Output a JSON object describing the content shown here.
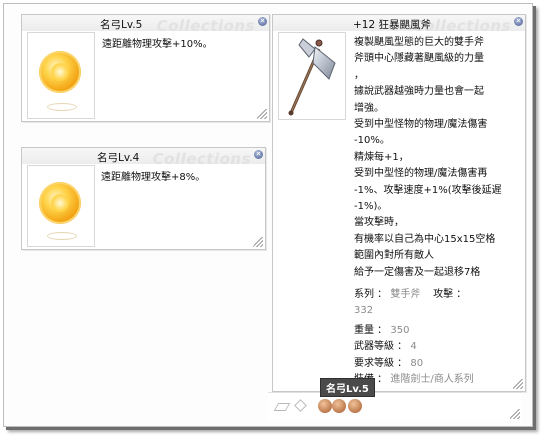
{
  "watermark": "Collections",
  "windows": [
    {
      "title": "名弓Lv.5",
      "desc": "遠距離物理攻擊+10%。"
    },
    {
      "title": "名弓Lv.4",
      "desc": "遠距離物理攻擊+8%。"
    }
  ],
  "item": {
    "title": "+12 狂暴颶風斧",
    "description_lines": [
      "複製颶風型態的巨大的雙手斧",
      "斧頭中心隱藏著颶風級的力量",
      "，",
      "據說武器越強時力量也會一起",
      "增強。",
      "受到中型怪物的物理/魔法傷害",
      "-10%。",
      "精煉每+1，",
      "受到中型怪的物理/魔法傷害再",
      "-1%、攻擊速度+1%(攻擊後延遲",
      "-1%)。",
      "當攻擊時，",
      "有機率以自己為中心15x15空格",
      "範圍內對所有敵人",
      "給予一定傷害及一起退移7格"
    ],
    "stats": {
      "series_label": "系列 ：",
      "series_value": "雙手斧",
      "attack_label": "攻擊 ：",
      "attack_value": "332",
      "weight_label": "重量 ：",
      "weight_value": "350",
      "weapon_level_label": "武器等級 ：",
      "weapon_level_value": "4",
      "req_level_label": "要求等級 ：",
      "req_level_value": "80",
      "equip_label": "裝備 ：",
      "equip_value": "進階劍士/商人系列"
    }
  },
  "tooltip": "名弓Lv.5",
  "colors": {
    "close_button": "#4b5f94",
    "stat_value": "#8b8b8b"
  }
}
